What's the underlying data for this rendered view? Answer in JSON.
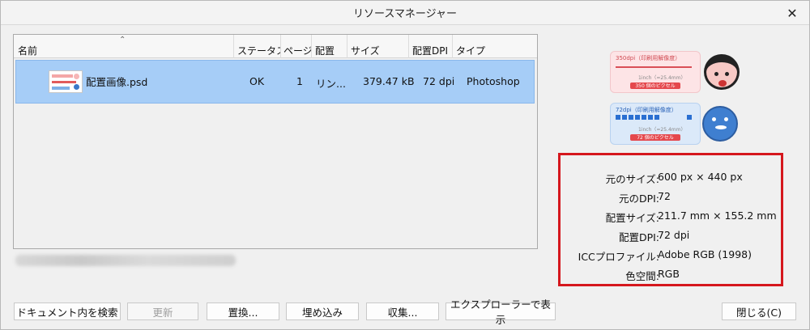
{
  "window": {
    "title": "リソースマネージャー",
    "close_glyph": "✕"
  },
  "list": {
    "sort_glyph": "⌃",
    "columns": [
      "名前",
      "ステータス",
      "ページ",
      "配置",
      "サイズ",
      "配置DPI",
      "タイプ"
    ],
    "rows": [
      {
        "name": "配置画像.psd",
        "status": "OK",
        "page": "1",
        "placement": "リン...",
        "size": "379.47 kB",
        "dpi": "72 dpi",
        "type": "Photoshop"
      }
    ]
  },
  "preview": {
    "card1": {
      "label": "350dpi（印刷用解像度）",
      "unit": "1inch（=25.4mm）",
      "pixels": "350 個のピクセル"
    },
    "card2": {
      "label": "72dpi（印刷用解像度）",
      "unit": "1inch（=25.4mm）",
      "pixels": "72 個のピクセル"
    }
  },
  "info": {
    "items": [
      {
        "key": "元のサイズ:",
        "value": "600 px × 440 px"
      },
      {
        "key": "元のDPI:",
        "value": "72"
      },
      {
        "key": "配置サイズ:",
        "value": "211.7 mm × 155.2 mm"
      },
      {
        "key": "配置DPI:",
        "value": "72 dpi"
      },
      {
        "key": "ICCプロファイル:",
        "value": "Adobe RGB (1998)"
      },
      {
        "key": "色空間:",
        "value": "RGB"
      }
    ],
    "highlight_color": "#d5171d"
  },
  "buttons": {
    "search_doc": "ドキュメント内を検索",
    "update": "更新",
    "replace": "置換...",
    "embed": "埋め込み",
    "collect": "収集...",
    "show_explorer": "エクスプローラーで表示",
    "close": "閉じる(C)"
  },
  "colors": {
    "selection": "#a6cdf7"
  }
}
